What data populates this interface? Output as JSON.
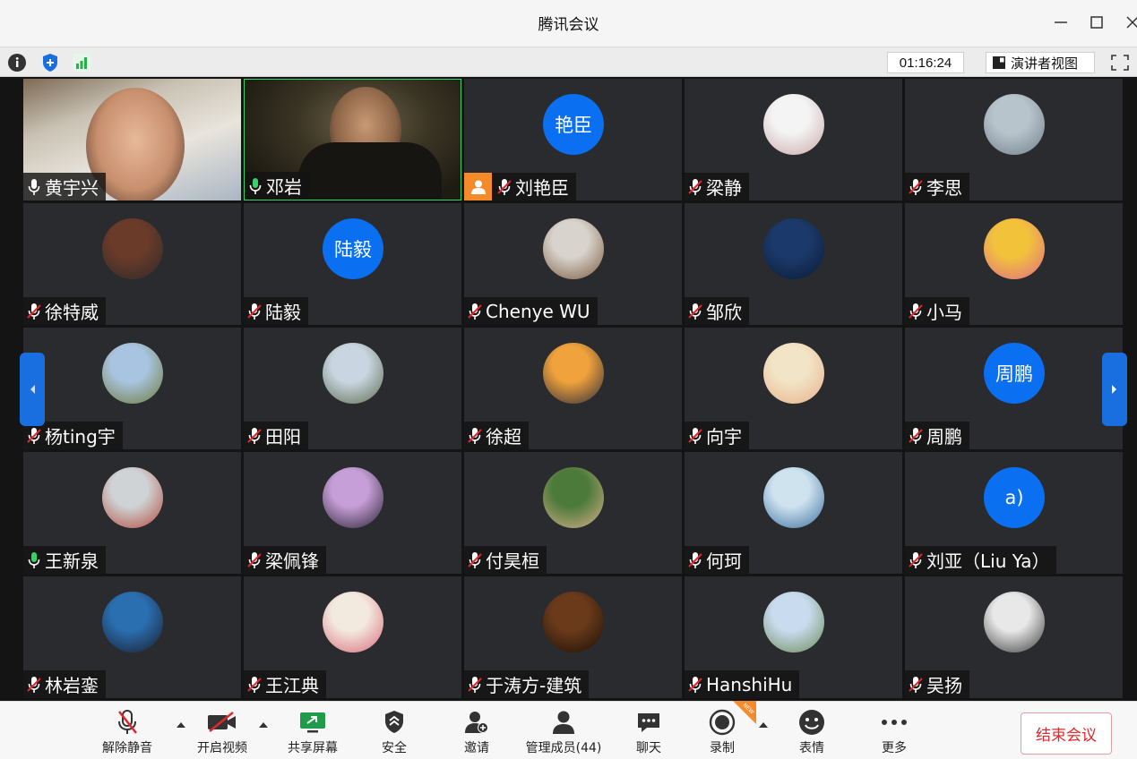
{
  "window": {
    "title": "腾讯会议"
  },
  "infobar": {
    "timer": "01:16:24",
    "speaker_view_label": "演讲者视图"
  },
  "participants": [
    {
      "name": "黄宇兴",
      "mic": "on",
      "kind": "video1"
    },
    {
      "name": "邓岩",
      "mic": "on",
      "kind": "video2"
    },
    {
      "name": "刘艳臣",
      "mic": "off",
      "kind": "text",
      "avatar_text": "艳臣",
      "host": true
    },
    {
      "name": "梁静",
      "mic": "off",
      "kind": "photo",
      "colors": [
        "#f4f4f4",
        "#c9a7a7"
      ]
    },
    {
      "name": "李思",
      "mic": "off",
      "kind": "photo",
      "colors": [
        "#b8c4cc",
        "#6f7f8c"
      ]
    },
    {
      "name": "徐特威",
      "mic": "off",
      "kind": "photo",
      "colors": [
        "#6b3b2a",
        "#2c2a2a"
      ]
    },
    {
      "name": "陆毅",
      "mic": "off",
      "kind": "text",
      "avatar_text": "陆毅"
    },
    {
      "name": "Chenye WU",
      "mic": "off",
      "kind": "photo",
      "colors": [
        "#d8d3cc",
        "#7a5a3f"
      ]
    },
    {
      "name": "邹欣",
      "mic": "off",
      "kind": "photo",
      "colors": [
        "#1b3a6b",
        "#0a1a33"
      ]
    },
    {
      "name": "小马",
      "mic": "off",
      "kind": "photo",
      "colors": [
        "#f2c23b",
        "#e06a8a"
      ]
    },
    {
      "name": "杨ting宇",
      "mic": "off",
      "kind": "photo",
      "colors": [
        "#a9c4e0",
        "#6c7a3a"
      ]
    },
    {
      "name": "田阳",
      "mic": "off",
      "kind": "photo",
      "colors": [
        "#c9d6e2",
        "#5d6b4f"
      ]
    },
    {
      "name": "徐超",
      "mic": "off",
      "kind": "photo",
      "colors": [
        "#f0a23c",
        "#2a2a3a"
      ]
    },
    {
      "name": "向宇",
      "mic": "off",
      "kind": "photo",
      "colors": [
        "#f2e4c6",
        "#e8b08a"
      ]
    },
    {
      "name": "周鹏",
      "mic": "off",
      "kind": "text",
      "avatar_text": "周鹏"
    },
    {
      "name": "王新泉",
      "mic": "on",
      "kind": "photo",
      "colors": [
        "#cfd3d6",
        "#b24a3a"
      ]
    },
    {
      "name": "梁佩锋",
      "mic": "off",
      "kind": "photo",
      "colors": [
        "#c79fd8",
        "#2a2233"
      ]
    },
    {
      "name": "付昊桓",
      "mic": "off",
      "kind": "photo",
      "colors": [
        "#4c7a3a",
        "#d9b08a"
      ]
    },
    {
      "name": "何珂",
      "mic": "off",
      "kind": "photo",
      "colors": [
        "#cfe3ef",
        "#3a6fa0"
      ]
    },
    {
      "name": "刘亚（Liu Ya）",
      "mic": "off",
      "kind": "text",
      "avatar_text": "a)"
    },
    {
      "name": "林岩銮",
      "mic": "off",
      "kind": "photo",
      "colors": [
        "#2a6fb0",
        "#1b1b2a"
      ]
    },
    {
      "name": "王江典",
      "mic": "off",
      "kind": "photo",
      "colors": [
        "#f3eadf",
        "#d86a7a"
      ]
    },
    {
      "name": "于涛方-建筑",
      "mic": "off",
      "kind": "photo",
      "colors": [
        "#6a3a1a",
        "#1a0f08"
      ]
    },
    {
      "name": "HanshiHu",
      "mic": "off",
      "kind": "photo",
      "colors": [
        "#c9dcef",
        "#6c8a5a"
      ]
    },
    {
      "name": "吴扬",
      "mic": "off",
      "kind": "photo",
      "colors": [
        "#e8e8e8",
        "#3a3a3a"
      ]
    }
  ],
  "toolbar": {
    "unmute": "解除静音",
    "start_video": "开启视频",
    "share_screen": "共享屏幕",
    "security": "安全",
    "invite": "邀请",
    "manage_members": "管理成员(44)",
    "chat": "聊天",
    "record": "录制",
    "reactions": "表情",
    "more": "更多",
    "end_meeting": "结束会议",
    "new_badge": "NEW"
  },
  "colors": {
    "accent": "#0a6ff0",
    "end": "#e2262b",
    "host_badge": "#f58a2a"
  }
}
